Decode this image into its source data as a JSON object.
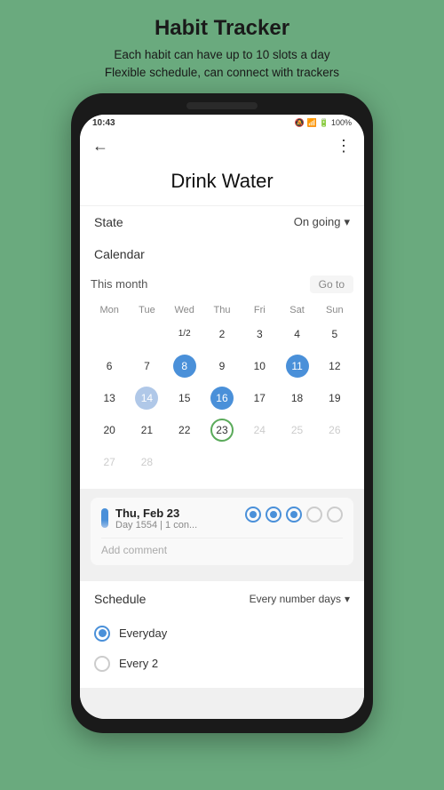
{
  "page": {
    "title": "Habit Tracker",
    "subtitle_line1": "Each habit can have up to 10 slots a day",
    "subtitle_line2": "Flexible schedule, can connect with trackers"
  },
  "status_bar": {
    "time": "10:43",
    "icons": "🔕 📶 🔋 100%"
  },
  "toolbar": {
    "back_icon": "←",
    "more_icon": "⋮"
  },
  "habit": {
    "name": "Drink Water",
    "state_label": "State",
    "state_value": "On going"
  },
  "calendar": {
    "section_label": "Calendar",
    "month_label": "This month",
    "go_to_label": "Go to",
    "day_headers": [
      "Mon",
      "Tue",
      "Wed",
      "Thu",
      "Fri",
      "Sat",
      "Sun"
    ],
    "weeks": [
      [
        {
          "day": "",
          "type": "empty"
        },
        {
          "day": "",
          "type": "empty"
        },
        {
          "day": "1⁄2",
          "type": "normal"
        },
        {
          "day": "2",
          "type": "normal"
        },
        {
          "day": "3",
          "type": "normal"
        },
        {
          "day": "4",
          "type": "normal"
        },
        {
          "day": "5",
          "type": "normal"
        }
      ],
      [
        {
          "day": "6",
          "type": "normal"
        },
        {
          "day": "7",
          "type": "normal"
        },
        {
          "day": "8",
          "type": "filled-blue"
        },
        {
          "day": "9",
          "type": "normal"
        },
        {
          "day": "10",
          "type": "normal"
        },
        {
          "day": "11",
          "type": "filled-blue"
        },
        {
          "day": "12",
          "type": "normal"
        }
      ],
      [
        {
          "day": "13",
          "type": "normal"
        },
        {
          "day": "14",
          "type": "filled-light"
        },
        {
          "day": "15",
          "type": "normal"
        },
        {
          "day": "16",
          "type": "filled-blue"
        },
        {
          "day": "17",
          "type": "normal"
        },
        {
          "day": "18",
          "type": "normal"
        },
        {
          "day": "19",
          "type": "normal"
        }
      ],
      [
        {
          "day": "20",
          "type": "normal"
        },
        {
          "day": "21",
          "type": "normal"
        },
        {
          "day": "22",
          "type": "normal"
        },
        {
          "day": "23",
          "type": "today"
        },
        {
          "day": "24",
          "type": "grayed"
        },
        {
          "day": "25",
          "type": "grayed"
        },
        {
          "day": "26",
          "type": "grayed"
        }
      ],
      [
        {
          "day": "27",
          "type": "grayed"
        },
        {
          "day": "28",
          "type": "grayed"
        },
        {
          "day": "",
          "type": "empty"
        },
        {
          "day": "",
          "type": "empty"
        },
        {
          "day": "",
          "type": "empty"
        },
        {
          "day": "",
          "type": "empty"
        },
        {
          "day": "",
          "type": "empty"
        }
      ]
    ]
  },
  "day_detail": {
    "date": "Thu, Feb 23",
    "sub": "Day 1554 | 1 con...",
    "slots": [
      "filled",
      "filled",
      "filled",
      "empty",
      "empty"
    ],
    "add_comment": "Add comment"
  },
  "schedule": {
    "label": "Schedule",
    "value": "Every number days",
    "options": [
      {
        "label": "Everyday",
        "checked": true
      },
      {
        "label": "Every  2",
        "checked": false
      }
    ]
  }
}
